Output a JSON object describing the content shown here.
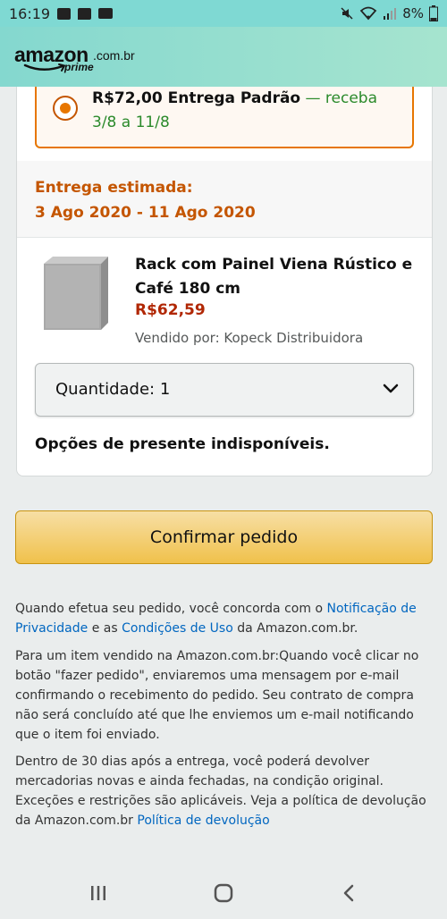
{
  "status_bar": {
    "time": "16:19",
    "battery": "8%",
    "left_icons": [
      "image-icon",
      "chat-icon",
      "data-icon"
    ],
    "right_icons": [
      "mute-icon",
      "wifi-icon",
      "signal-icon",
      "battery-icon"
    ]
  },
  "header": {
    "logo_word": "amazon",
    "logo_domain": ".com.br",
    "logo_prime": "prime"
  },
  "shipping_option": {
    "price_label": "R$72,00 Entrega Padrão",
    "green_text": " — receba 3/8 a 11/8",
    "selected": true
  },
  "delivery": {
    "title": "Entrega estimada:",
    "dates": "3 Ago 2020 - 11 Ago 2020"
  },
  "product": {
    "name": "Rack com Painel Viena Rústico e Café 180 cm",
    "price": "R$62,59",
    "seller": "Vendido por: Kopeck Distribuidora",
    "quantity_label": "Quantidade: 1"
  },
  "gift_options": "Opções de presente indisponíveis.",
  "confirm_button": "Confirmar pedido",
  "legal": {
    "p1_before": "Quando efetua seu pedido, você concorda com o ",
    "p1_link1": "Notificação de Privacidade",
    "p1_mid": " e as ",
    "p1_link2": "Condições de Uso",
    "p1_after": " da Amazon.com.br.",
    "p2": "Para um item vendido na Amazon.com.br:Quando você clicar no botão \"fazer pedido\", enviaremos uma mensagem por e-mail confirmando o recebimento do pedido. Seu contrato de compra não será concluído até que lhe enviemos um e-mail notificando que o item foi enviado.",
    "p3_before": "Dentro de 30 dias após a entrega, você poderá devolver mercadorias novas e ainda fechadas, na condição original. Exceções e restrições são aplicáveis. Veja a política de devolução da Amazon.com.br ",
    "p3_link": "Política de devolução"
  },
  "colors": {
    "status_bar": "#7fd9d3",
    "header_gradient_start": "#84d8cf",
    "accent_orange": "#c45500",
    "price_red": "#b12704",
    "link_blue": "#0066c0",
    "button_yellow": "#f0c14b",
    "green": "#2b8a2b"
  },
  "nav_bar": {
    "icons": [
      "recents-icon",
      "home-icon",
      "back-icon"
    ]
  }
}
